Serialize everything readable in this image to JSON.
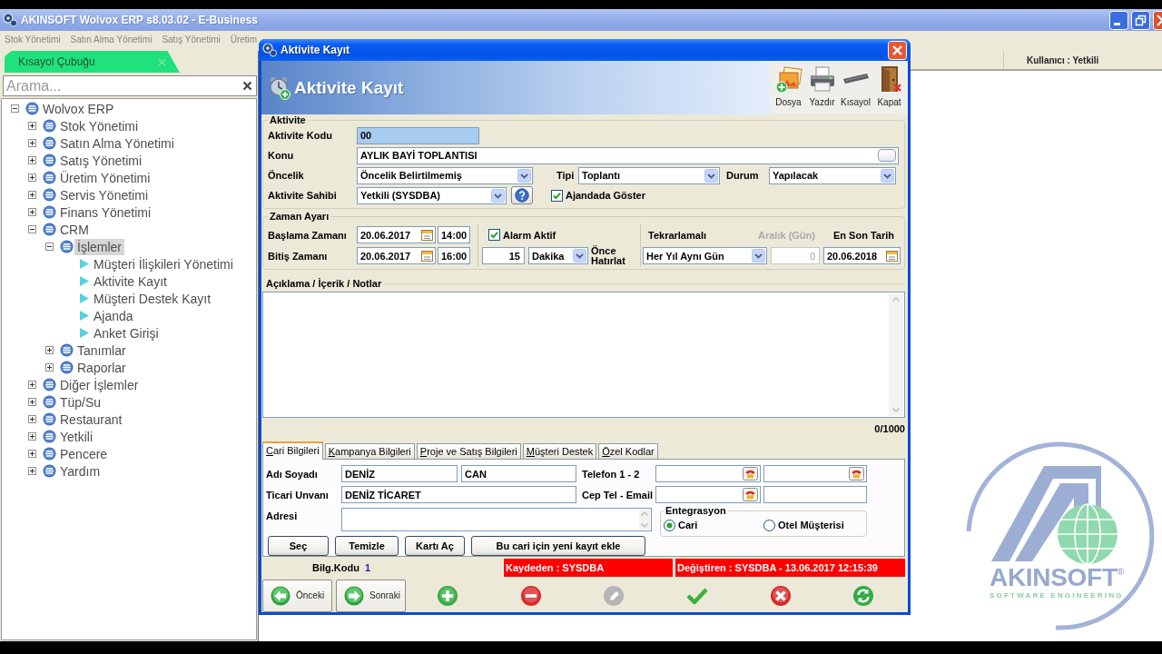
{
  "app": {
    "title": "AKINSOFT Wolvox ERP s8.03.02 - E-Business"
  },
  "menu": [
    "Stok Yönetimi",
    "Satın Alma Yönetimi",
    "Satış Yönetimi",
    "Üretim"
  ],
  "sidebar": {
    "tab": "Kısayol Çubuğu",
    "search": {
      "placeholder": "Arama..."
    },
    "tree": [
      {
        "label": "Wolvox ERP",
        "kind": "group",
        "expanded": true,
        "selected": false,
        "children": [
          {
            "label": "Stok Yönetimi",
            "kind": "group",
            "expanded": false,
            "selected": false
          },
          {
            "label": "Satın Alma Yönetimi",
            "kind": "group",
            "expanded": false,
            "selected": false
          },
          {
            "label": "Satış Yönetimi",
            "kind": "group",
            "expanded": false,
            "selected": false
          },
          {
            "label": "Üretim Yönetimi",
            "kind": "group",
            "expanded": false,
            "selected": false
          },
          {
            "label": "Servis Yönetimi",
            "kind": "group",
            "expanded": false,
            "selected": false
          },
          {
            "label": "Finans Yönetimi",
            "kind": "group",
            "expanded": false,
            "selected": false
          },
          {
            "label": "CRM",
            "kind": "group",
            "expanded": true,
            "selected": false,
            "children": [
              {
                "label": "İşlemler",
                "kind": "group",
                "expanded": true,
                "selected": true,
                "children": [
                  {
                    "label": "Müşteri İlişkileri Yönetimi",
                    "kind": "leaf",
                    "selected": false
                  },
                  {
                    "label": "Aktivite Kayıt",
                    "kind": "leaf",
                    "selected": false
                  },
                  {
                    "label": "Müşteri Destek Kayıt",
                    "kind": "leaf",
                    "selected": false
                  },
                  {
                    "label": "Ajanda",
                    "kind": "leaf",
                    "selected": false
                  },
                  {
                    "label": "Anket Girişi",
                    "kind": "leaf",
                    "selected": false
                  }
                ]
              },
              {
                "label": "Tanımlar",
                "kind": "group",
                "expanded": false,
                "selected": false
              },
              {
                "label": "Raporlar",
                "kind": "group",
                "expanded": false,
                "selected": false
              }
            ]
          },
          {
            "label": "Diğer İşlemler",
            "kind": "group",
            "expanded": false,
            "selected": false
          },
          {
            "label": "Tüp/Su",
            "kind": "group",
            "expanded": false,
            "selected": false
          },
          {
            "label": "Restaurant",
            "kind": "group",
            "expanded": false,
            "selected": false
          },
          {
            "label": "Yetkili",
            "kind": "group",
            "expanded": false,
            "selected": false
          },
          {
            "label": "Pencere",
            "kind": "group",
            "expanded": false,
            "selected": false
          },
          {
            "label": "Yardım",
            "kind": "group",
            "expanded": false,
            "selected": false
          }
        ]
      }
    ]
  },
  "user_bar": {
    "label": "Kullanıcı : Yetkili"
  },
  "logo": {
    "wordmark": "AKINSOFT$^{®}$",
    "tagline": "SOFTWARE ENGINEERING"
  },
  "dialog": {
    "title": "Aktivite Kayıt",
    "heading": "Aktivite Kayıt",
    "tools": [
      {
        "kind": "files",
        "label": "Dosya"
      },
      {
        "kind": "print",
        "label": "Yazdır"
      },
      {
        "kind": "shortcut",
        "label": "Kısayol"
      },
      {
        "kind": "exit",
        "label": "Kapat"
      }
    ],
    "activity": {
      "legend": "Aktivite",
      "code": {
        "label": "Aktivite Kodu",
        "value": "00"
      },
      "subject": {
        "label": "Konu",
        "value": "AYLIK BAYİ TOPLANTISI"
      },
      "priority": {
        "label": "Öncelik",
        "value": "Öncelik Belirtilmemiş"
      },
      "type": {
        "label": "Tipi",
        "value": "Toplantı"
      },
      "status": {
        "label": "Durum",
        "value": "Yapılacak"
      },
      "owner": {
        "label": "Aktivite Sahibi",
        "value": "Yetkili (SYSDBA)"
      },
      "show_in_agenda": {
        "label": "Ajandada Göster",
        "checked": true
      }
    },
    "time": {
      "legend": "Zaman Ayarı",
      "start": {
        "label": "Başlama Zamanı",
        "date": "20.06.2017",
        "time": "14:00"
      },
      "end": {
        "label": "Bitiş Zamanı",
        "date": "20.06.2017",
        "time": "16:00"
      },
      "alarm": {
        "label": "Alarm Aktif",
        "checked": true
      },
      "remind": {
        "amount": "15",
        "unit": "Dakika",
        "label": "Önce Hatırlat"
      },
      "repeat": {
        "label": "Tekrarlamalı",
        "value": "Her Yıl Aynı Gün"
      },
      "interval": {
        "label": "Aralık (Gün)",
        "value": "0",
        "disabled": true
      },
      "last_date": {
        "label": "En Son Tarih",
        "value": "20.06.2018"
      }
    },
    "notes": {
      "legend": "Açıklama / İçerik / Notlar",
      "counter": "0/1000"
    },
    "tabs": [
      {
        "label": "Cari Bilgileri",
        "selected": true
      },
      {
        "label": "Kampanya Bilgileri",
        "selected": false
      },
      {
        "label": "Proje ve Satış Bilgileri",
        "selected": false
      },
      {
        "label": "Müşteri Destek",
        "selected": false
      },
      {
        "label": "Özel Kodlar",
        "selected": false
      }
    ],
    "account": {
      "name": {
        "label": "Adı Soyadı",
        "first": "DENİZ",
        "last": "CAN"
      },
      "phones": {
        "label": "Telefon 1 - 2"
      },
      "company": {
        "label": "Ticari Unvanı",
        "value": "DENİZ TİCARET"
      },
      "mobile_email": {
        "label": "Cep Tel - Email"
      },
      "address": {
        "label": "Adresi"
      },
      "integration": {
        "legend": "Entegrasyon",
        "options": [
          {
            "label": "Cari",
            "selected": true
          },
          {
            "label": "Otel Müşterisi",
            "selected": false
          }
        ]
      },
      "buttons": [
        "Seç",
        "Temizle",
        "Kartı Aç",
        "Bu cari için yeni kayıt ekle"
      ]
    },
    "status": {
      "code_label": "Bilg.Kodu",
      "code": "1",
      "saved_by": "Kaydeden : SYSDBA",
      "changed_by": "Değiştiren : SYSDBA - 13.06.2017 12:15:39"
    },
    "nav": [
      {
        "kind": "prev",
        "label": "Önceki"
      },
      {
        "kind": "next",
        "label": "Sonraki"
      }
    ],
    "actions": [
      {
        "kind": "add",
        "disabled": false
      },
      {
        "kind": "delete",
        "disabled": false
      },
      {
        "kind": "edit",
        "disabled": true
      },
      {
        "kind": "save",
        "disabled": false
      },
      {
        "kind": "cancel",
        "disabled": false
      },
      {
        "kind": "refresh",
        "disabled": false
      }
    ]
  }
}
